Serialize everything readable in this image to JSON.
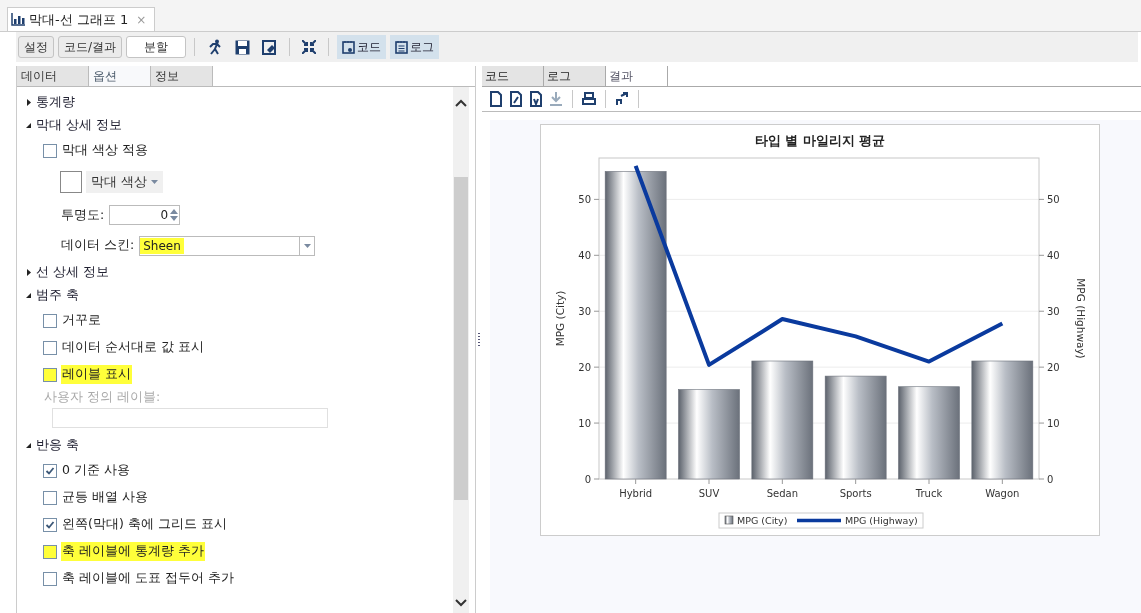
{
  "document_tab": {
    "title": "막대-선 그래프 1",
    "close": "×"
  },
  "toolbar": {
    "view_buttons": [
      {
        "label": "설정",
        "selected": false
      },
      {
        "label": "코드/결과",
        "selected": false
      },
      {
        "label": "분할",
        "selected": true
      }
    ],
    "toggles": [
      {
        "label": "코드",
        "on": true,
        "kind": "code"
      },
      {
        "label": "로그",
        "on": true,
        "kind": "log"
      }
    ]
  },
  "left_tabs": [
    {
      "label": "데이터",
      "selected": false
    },
    {
      "label": "옵션",
      "selected": true
    },
    {
      "label": "정보",
      "selected": false
    }
  ],
  "options": [
    {
      "kind": "section",
      "label": "통계량",
      "expanded": false
    },
    {
      "kind": "section",
      "label": "막대 상세 정보",
      "expanded": true,
      "children": [
        {
          "kind": "checkbox",
          "label": "막대 색상 적용",
          "checked": false,
          "highlighted": false,
          "children": [
            {
              "kind": "color",
              "label": "막대 색상"
            },
            {
              "kind": "spinner",
              "label": "투명도:",
              "value": "0"
            },
            {
              "kind": "dropdown",
              "label": "데이터 스킨:",
              "value": "Sheen",
              "highlighted": true
            }
          ]
        }
      ]
    },
    {
      "kind": "section",
      "label": "선 상세 정보",
      "expanded": false
    },
    {
      "kind": "section",
      "label": "범주 축",
      "expanded": true,
      "children": [
        {
          "kind": "checkbox",
          "label": "거꾸로",
          "checked": false,
          "highlighted": false
        },
        {
          "kind": "checkbox",
          "label": "데이터 순서대로 값 표시",
          "checked": false,
          "highlighted": false
        },
        {
          "kind": "checkbox",
          "label": "레이블 표시",
          "checked": false,
          "highlighted": true
        },
        {
          "kind": "text_field",
          "label": "사용자 정의 레이블:",
          "disabled": true
        }
      ]
    },
    {
      "kind": "section",
      "label": "반응 축",
      "expanded": true,
      "children": [
        {
          "kind": "checkbox",
          "label": "0 기준 사용",
          "checked": true,
          "highlighted": false
        },
        {
          "kind": "checkbox",
          "label": "균등 배열 사용",
          "checked": false,
          "highlighted": false
        },
        {
          "kind": "checkbox",
          "label": "왼쪽(막대) 축에 그리드 표시",
          "checked": true,
          "highlighted": false
        },
        {
          "kind": "checkbox",
          "label": "축 레이블에 통계량 추가",
          "checked": false,
          "highlighted": true
        },
        {
          "kind": "checkbox",
          "label": "축 레이블에 도표 접두어 추가",
          "checked": false,
          "highlighted": false
        }
      ]
    }
  ],
  "right_tabs": [
    {
      "label": "코드",
      "selected": false
    },
    {
      "label": "로그",
      "selected": false
    },
    {
      "label": "결과",
      "selected": true
    }
  ],
  "result": {
    "chart_data": {
      "type": "bar",
      "title": "타입 별 마일리지 평균",
      "ylabel": "MPG (City)",
      "y2label": "MPG (Highway)",
      "categories": [
        "Hybrid",
        "SUV",
        "Sedan",
        "Sports",
        "Truck",
        "Wagon"
      ],
      "series": [
        {
          "name": "MPG (City)",
          "type": "bar",
          "color": "#6b717b",
          "values": [
            55,
            16,
            21.1,
            18.4,
            16.5,
            21.1
          ]
        },
        {
          "name": "MPG (Highway)",
          "type": "line",
          "color": "#0a3a9e",
          "values": [
            56,
            20.4,
            28.6,
            25.5,
            21,
            27.8
          ]
        }
      ],
      "grid": true,
      "legend": true,
      "ylim": [
        0,
        57.4
      ],
      "y2lim": [
        0,
        57.4
      ],
      "yticks": [
        0,
        10,
        20,
        30,
        40,
        50
      ],
      "y2ticks": [
        0,
        10,
        20,
        30,
        40,
        50
      ]
    }
  }
}
